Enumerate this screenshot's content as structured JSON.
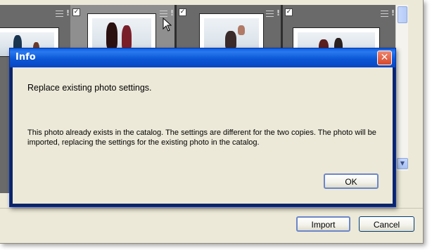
{
  "dialog": {
    "title": "Info",
    "close_icon": "close-icon",
    "heading": "Replace existing photo settings.",
    "message": "This photo already exists in the catalog. The settings are different for the two copies. The photo will be imported, replacing the settings for the existing photo in the catalog.",
    "ok_label": "OK"
  },
  "footer": {
    "import_label": "Import",
    "cancel_label": "Cancel"
  },
  "grid": {
    "cells": [
      {
        "checked": true,
        "selected": false
      },
      {
        "checked": true,
        "selected": true
      },
      {
        "checked": true,
        "selected": false
      },
      {
        "checked": true,
        "selected": false
      }
    ],
    "check_glyph": "✓"
  },
  "colors": {
    "titlebar": "#0b57d6",
    "window_bg": "#ece9d8",
    "close_button": "#d5472b"
  }
}
